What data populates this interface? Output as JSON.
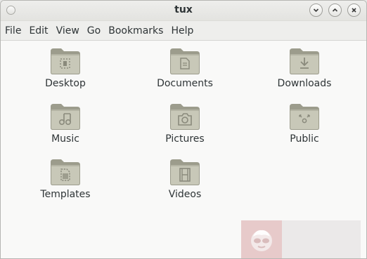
{
  "window": {
    "title": "tux"
  },
  "menu": [
    "File",
    "Edit",
    "View",
    "Go",
    "Bookmarks",
    "Help"
  ],
  "icons": [
    {
      "label": "Desktop",
      "icon": "desktop-folder-icon"
    },
    {
      "label": "Documents",
      "icon": "documents-folder-icon"
    },
    {
      "label": "Downloads",
      "icon": "downloads-folder-icon"
    },
    {
      "label": "Music",
      "icon": "music-folder-icon"
    },
    {
      "label": "Pictures",
      "icon": "pictures-folder-icon"
    },
    {
      "label": "Public",
      "icon": "public-folder-icon"
    },
    {
      "label": "Templates",
      "icon": "templates-folder-icon"
    },
    {
      "label": "Videos",
      "icon": "videos-folder-icon"
    }
  ],
  "colors": {
    "folder": "#9c9c8c",
    "folder_light": "#c8c8b8",
    "text": "#2e3436"
  }
}
